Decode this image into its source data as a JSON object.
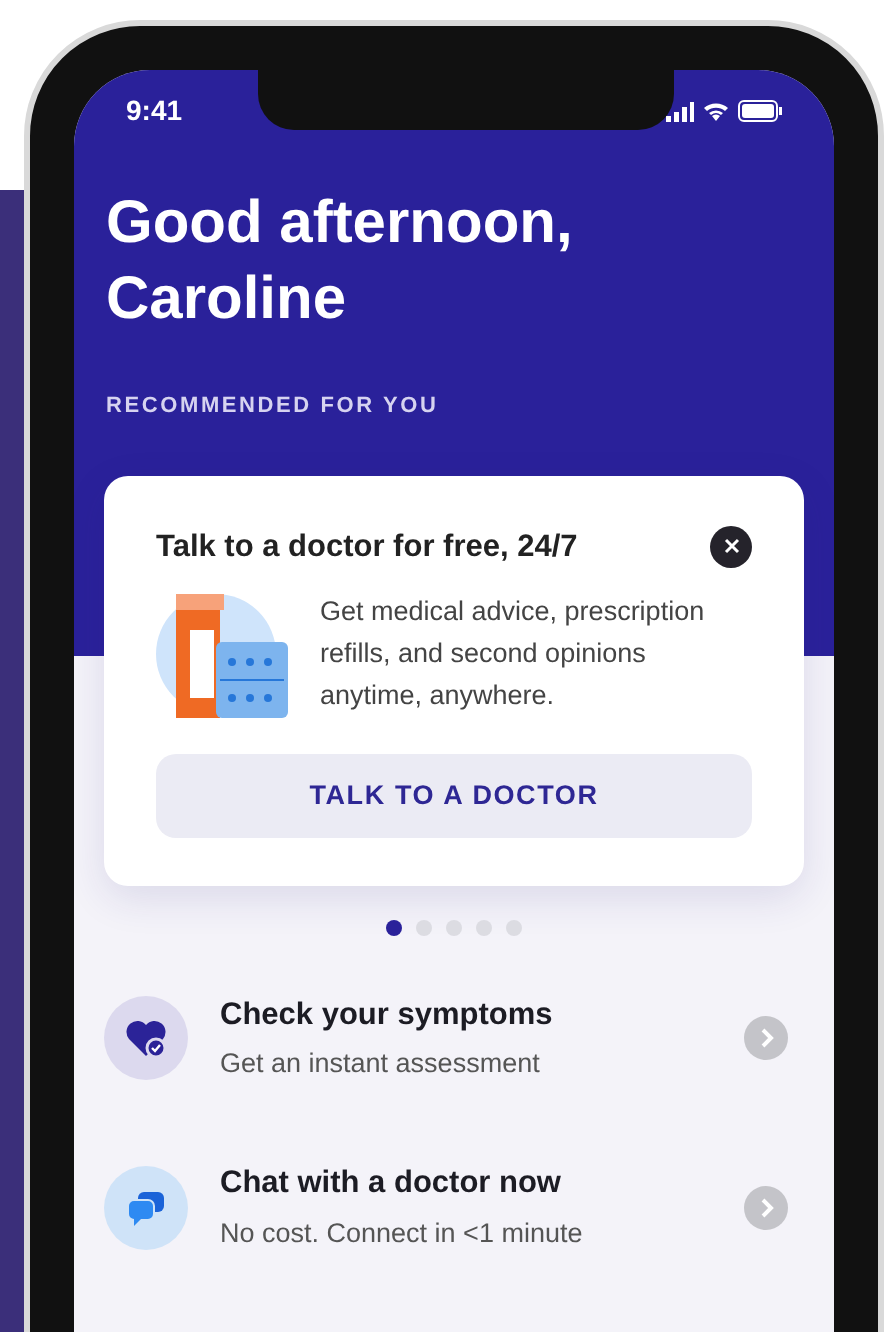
{
  "status_bar": {
    "time": "9:41"
  },
  "greeting": "Good afternoon, Caroline",
  "section_label": "RECOMMENDED FOR YOU",
  "card": {
    "title": "Talk to a doctor for free, 24/7",
    "description": "Get medical advice, prescription refills, and second opinions anytime, anywhere.",
    "button": "TALK TO A DOCTOR"
  },
  "pager": [
    {
      "selected": true
    },
    {
      "selected": false
    },
    {
      "selected": false
    },
    {
      "selected": false
    },
    {
      "selected": false
    }
  ],
  "actions": [
    {
      "title": "Check your symptoms",
      "subtitle": "Get an instant assessment"
    },
    {
      "title": "Chat with a doctor now",
      "subtitle": "No cost. Connect in <1 minute"
    }
  ]
}
